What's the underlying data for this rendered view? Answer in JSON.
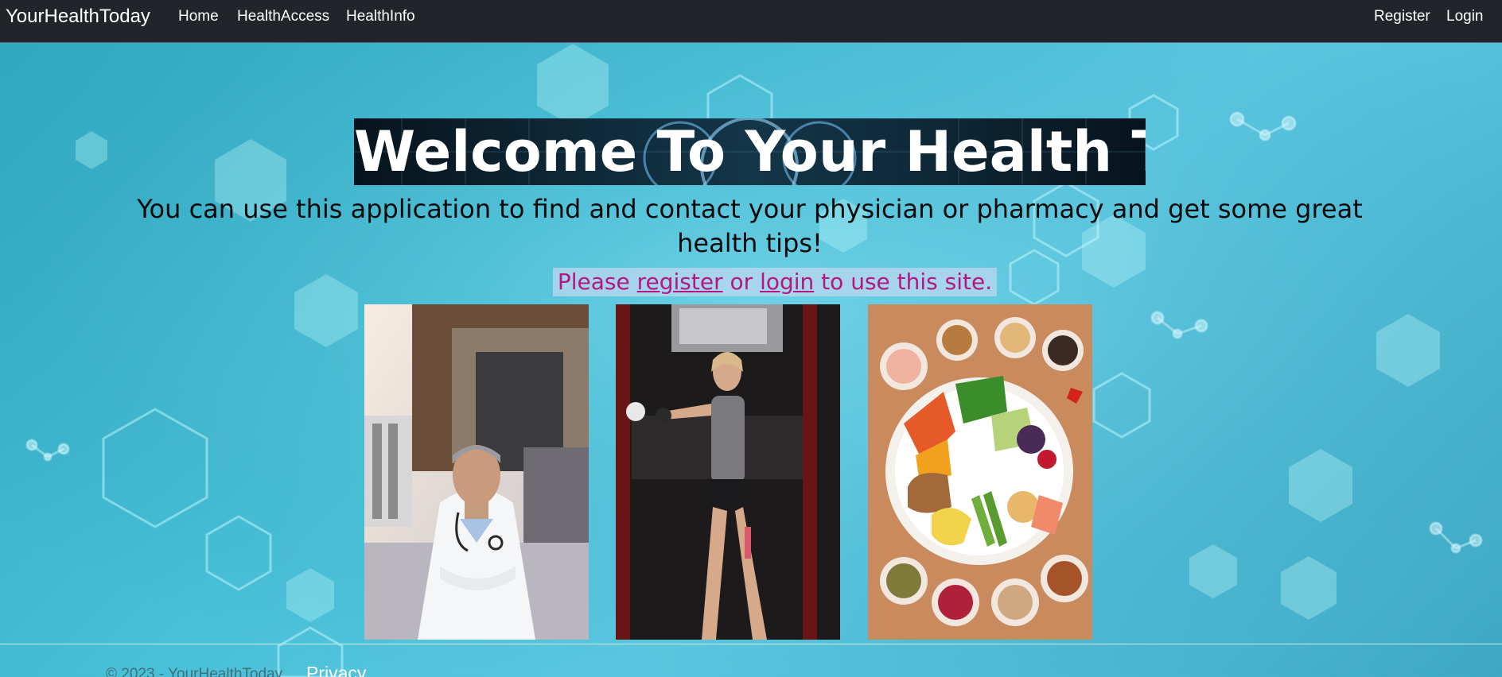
{
  "navbar": {
    "brand": "YourHealthToday",
    "links": [
      {
        "label": "Home"
      },
      {
        "label": "HealthAccess"
      },
      {
        "label": "HealthInfo"
      }
    ],
    "right_links": [
      {
        "label": "Register"
      },
      {
        "label": "Login"
      }
    ]
  },
  "hero": {
    "title": "Welcome To Your Health Today",
    "subtitle": "You can use this application to find and contact your physician or pharmacy and get some great health tips!",
    "cta": {
      "prefix": "Please ",
      "register": "register",
      "middle": " or ",
      "login": "login",
      "suffix": " to use this site."
    }
  },
  "images": [
    {
      "name": "doctor-photo"
    },
    {
      "name": "workout-photo"
    },
    {
      "name": "healthy-food-photo"
    }
  ],
  "footer": {
    "copyright": "© 2023 - YourHealthToday",
    "privacy": "Privacy"
  },
  "colors": {
    "navbar": "#212529",
    "cta_text": "#b5177f",
    "background": "#46bfd6"
  }
}
